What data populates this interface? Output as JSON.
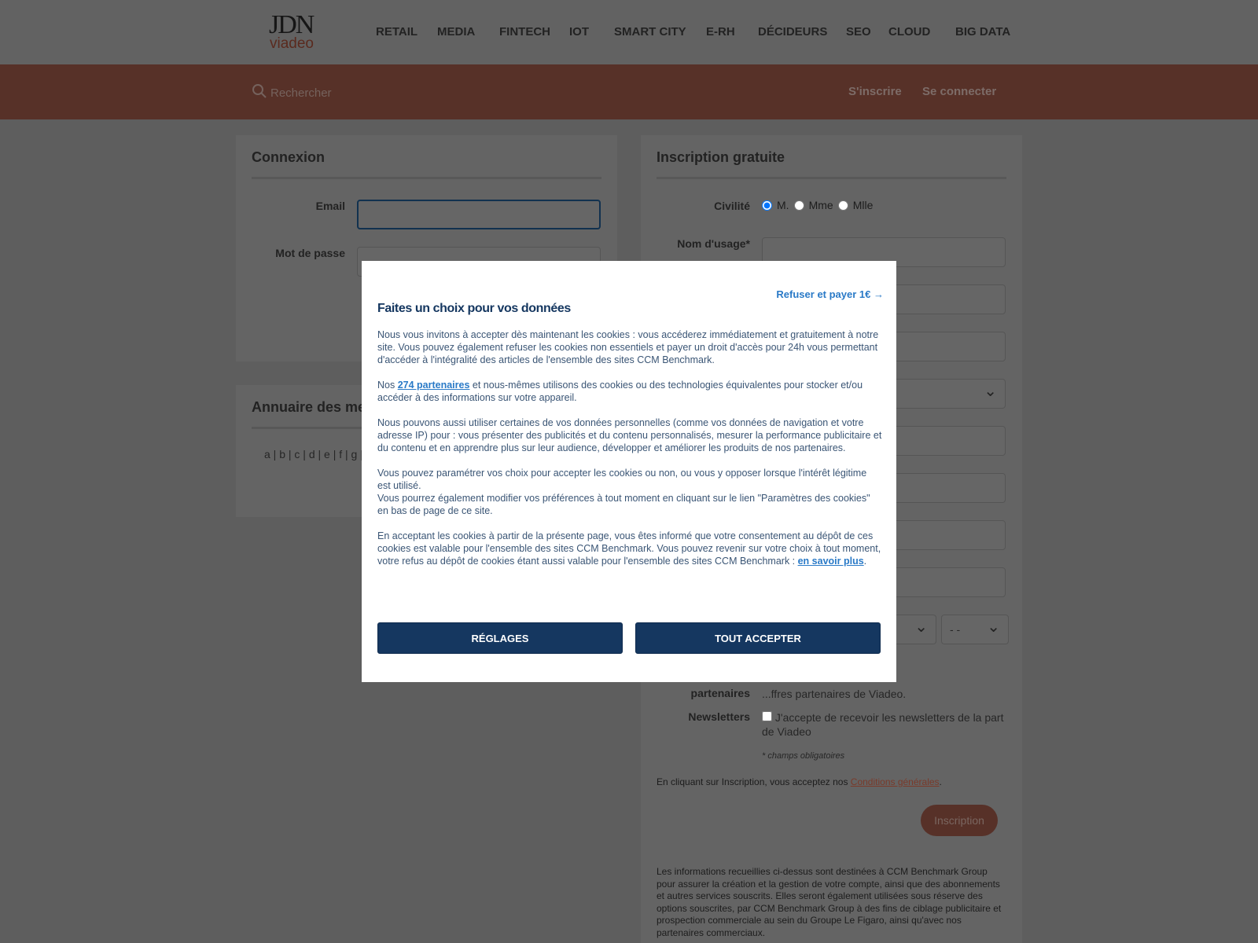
{
  "header": {
    "logo_top": "JDN",
    "logo_bottom": "viadeo",
    "nav": [
      "RETAIL",
      "MEDIA",
      "FINTECH",
      "IOT",
      "SMART CITY",
      "E-RH",
      "DÉCIDEURS",
      "SEO",
      "CLOUD",
      "BIG DATA"
    ]
  },
  "subbar": {
    "search_placeholder": "Rechercher",
    "signup": "S'inscrire",
    "login": "Se connecter"
  },
  "login": {
    "title": "Connexion",
    "email_label": "Email",
    "password_label": "Mot de passe"
  },
  "directory": {
    "title": "Annuaire des me",
    "letters": "a | b | c | d | e | f | g | h"
  },
  "signup": {
    "title": "Inscription gratuite",
    "civility_label": "Civilité",
    "civility_options": [
      "M.",
      "Mme",
      "Mlle"
    ],
    "civility_selected": "M.",
    "name_label": "Nom d'usage*",
    "date_placeholder": "- -",
    "partners_label": "partenaires",
    "partners_text": "...ffres partenaires de Viadeo.",
    "newsletter_label": "Newsletters",
    "newsletter_text": "J'accepte de recevoir les newsletters de la part de Viadeo",
    "required_note": "* champs obligatoires",
    "terms_prefix": "En cliquant sur Inscription, vous acceptez nos ",
    "terms_link": "Conditions générales",
    "terms_suffix": ".",
    "submit": "Inscription",
    "legal": "Les informations recueillies ci-dessus sont destinées à CCM Benchmark Group pour assurer la création et la gestion de votre compte, ainsi que des abonnements et autres services souscrits. Elles seront également utilisées sous réserve des options souscrites, par CCM Benchmark Group à des fins de ciblage publicitaire et prospection commerciale au sein du Groupe Le Figaro, ainsi qu'avec nos partenaires commerciaux."
  },
  "modal": {
    "refuse": "Refuser et payer 1€ →",
    "title": "Faites un choix pour vos données",
    "p1": "Nous vous invitons à accepter dès maintenant les cookies : vous accéderez immédiatement et gratuitement à notre site. Vous pouvez également refuser les cookies non essentiels et payer un droit d'accès pour 24h vous permettant d'accéder à l'intégralité des articles de l'ensemble des sites CCM Benchmark.",
    "p2_prefix": "Nos ",
    "p2_link": "274 partenaires",
    "p2_suffix": " et nous-mêmes utilisons des cookies ou des technologies équivalentes pour stocker et/ou accéder à des informations sur votre appareil.",
    "p3": "Nous pouvons aussi utiliser certaines de vos données personnelles (comme vos données de navigation et votre adresse IP) pour : vous présenter des publicités et du contenu personnalisés, mesurer la performance publicitaire et du contenu et en apprendre plus sur leur audience, développer et améliorer les produits de nos partenaires.",
    "p4a": "Vous pouvez paramétrer vos choix pour accepter les cookies ou non, ou vous y opposer lorsque l'intérêt légitime est utilisé.",
    "p4b": "Vous pourrez également modifier vos préférences à tout moment en cliquant sur le lien \"Paramètres des cookies\" en bas de page de ce site.",
    "p5": "En acceptant les cookies à partir de la présente page, vous êtes informé que votre consentement au dépôt de ces cookies est valable pour l'ensemble des sites CCM Benchmark. Vous pouvez revenir sur votre choix à tout moment, votre refus au dépôt de cookies étant aussi valable pour l'ensemble des sites CCM Benchmark : ",
    "p5_link": "en savoir plus",
    "p5_suffix": ".",
    "settings": "RÉGLAGES",
    "accept": "TOUT ACCEPTER"
  },
  "colors": {
    "brand_orange": "#d97a63",
    "modal_button": "#153760",
    "link": "#2a7ac7"
  }
}
